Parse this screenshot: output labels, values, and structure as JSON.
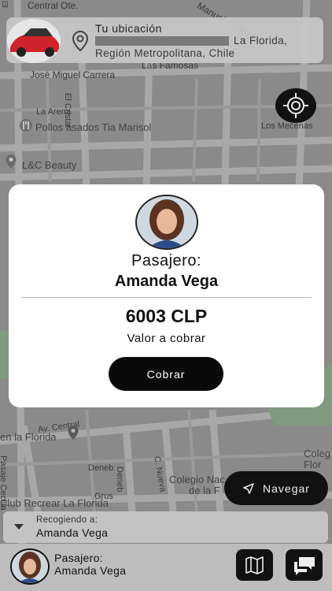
{
  "map": {
    "labels": [
      "Central Ote.",
      "El Pelícano",
      "Manuel Rodríguez",
      "Las Famosas",
      "José Miguel Carrera",
      "La Arena",
      "El Cristal",
      "Pollos asados Tia Marisol",
      "Los Mecenas",
      "L&C Beauty",
      "Av. Central",
      "en la Florida",
      "Deneb",
      "Pasaje Cecilia",
      "Club Recrear La Florida",
      "Deneb",
      "Grus",
      "C. Nueva",
      "Colegio Nac",
      "de la F",
      "Coleg",
      "Flor"
    ]
  },
  "location": {
    "title": "Tu ubicación",
    "address_tail": "La Florida,",
    "address_line2": "Región Metropolitana, Chile"
  },
  "modal": {
    "label": "Pasajero:",
    "name": "Amanda Vega",
    "amount": "6003 CLP",
    "subtitle": "Valor a cobrar",
    "button": "Cobrar"
  },
  "navigate": {
    "label": "Navegar"
  },
  "pickup": {
    "label": "Recogiendo a:",
    "name": "Amanda Vega"
  },
  "bottom": {
    "label": "Pasajero:",
    "name": "Amanda Vega"
  },
  "icons": {
    "pin": "location-pin-icon",
    "gps": "gps-target-icon",
    "nav": "navigation-arrow-icon",
    "map": "map-icon",
    "chat": "chat-icon"
  }
}
